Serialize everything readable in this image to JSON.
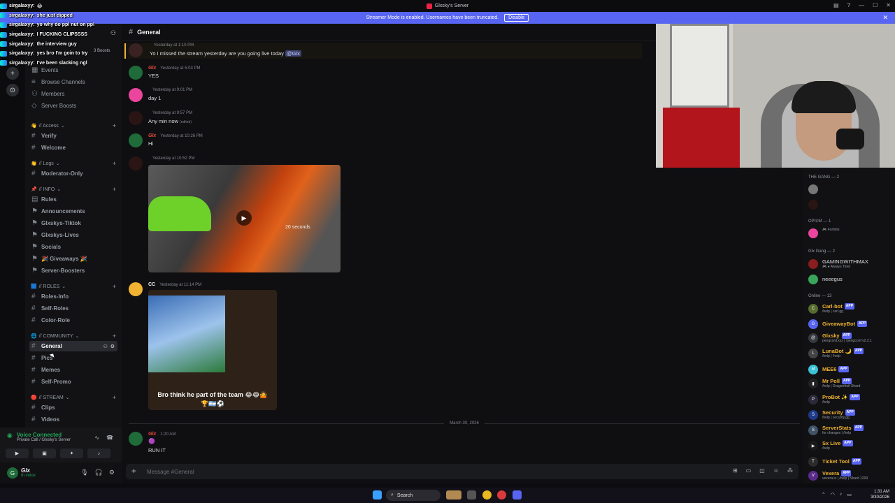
{
  "window": {
    "title": "Glxsky's Server"
  },
  "banner": {
    "text": "Streamer Mode is enabled. Usernames have been truncated.",
    "button": "Disable"
  },
  "overlay_chat": [
    {
      "user": "sirgalaxyy:",
      "text": "😂"
    },
    {
      "user": "sirgalaxyy:",
      "text": "she just dipped"
    },
    {
      "user": "sirgalaxyy:",
      "text": "yo why do ppl nut on ppl"
    },
    {
      "user": "sirgalaxyy:",
      "text": "I FUCKING CLIPSSSS"
    },
    {
      "user": "sirgalaxyy:",
      "text": "the interview guy"
    },
    {
      "user": "sirgalaxyy:",
      "text": "yes bro I'm goin to try"
    },
    {
      "user": "sirgalaxyy:",
      "text": "I've been slacking ngl"
    }
  ],
  "sidebar": {
    "server_boosts_pill": "3 Boosts",
    "top_items": [
      "Events",
      "Browse Channels",
      "Members",
      "Server Boosts"
    ],
    "categories": {
      "access": "// Access",
      "logs": "// Logs",
      "info": "// INFO",
      "roles": "// ROLES",
      "community": "// COMMUNITY",
      "stream": "// STREAM"
    },
    "channels": {
      "verify": "Verify",
      "welcome": "Welcome",
      "moderator_only": "Moderator-Only",
      "rules": "Rules",
      "announcements": "Announcements",
      "glxskys_tiktok": "Glxskys-Tiktok",
      "glxskys_lives": "Glxskys-Lives",
      "socials": "Socials",
      "giveaways": "🎉 Giveaways 🎉",
      "server_boosters": "Server-Boosters",
      "roles_info": "Roles-Info",
      "self_roles": "Self-Roles",
      "color_role": "Color-Role",
      "general": "General",
      "pics": "Pics",
      "memes": "Memes",
      "self_promo": "Self-Promo",
      "clips": "Clips",
      "videos": "Videos"
    }
  },
  "voice": {
    "status": "Voice Connected",
    "detail": "Private Call / Glxsky's Server"
  },
  "user_panel": {
    "name": "Glx",
    "status": "In voice"
  },
  "channel_header": {
    "name": "General"
  },
  "messages": [
    {
      "name": "",
      "time": "Yesterday at 1:10 PM",
      "text": "Yo I missed the stream yesterday are you going live today",
      "mention": "@Glx"
    },
    {
      "name": "Glx",
      "time": "Yesterday at 5:03 PM",
      "text": "YES"
    },
    {
      "name": "",
      "time": "Yesterday at 9:01 PM",
      "text": "day 1"
    },
    {
      "name": "",
      "time": "Yesterday at 9:57 PM",
      "text": "Any min  now",
      "edited": "(edited)"
    },
    {
      "name": "Glx",
      "time": "Yesterday at 10:26 PM",
      "text": "Hi"
    },
    {
      "name": "",
      "time": "Yesterday at 10:52 PM",
      "video_label": "20 seconds"
    },
    {
      "name": "CC",
      "time": "Yesterday at 11:14 PM",
      "caption": "Bro think he part of the team 😂😂🤷🏆🇦🇷⚽"
    },
    {
      "name": "Glx",
      "time": "1:20 AM",
      "text": "RUN IT"
    }
  ],
  "date_divider": "March 30, 2026",
  "composer": {
    "placeholder": "Message #General"
  },
  "members": {
    "groups": [
      "THE GANG — 2",
      "OPIUM — 1",
      "Glx Gang — 2",
      "Online — 13"
    ],
    "opium": [
      {
        "name": "",
        "status": "🎮 Fortnite"
      }
    ],
    "glx_gang": [
      {
        "name": "GAMINGWITHMAX",
        "status": "🎮 ● Always Tired"
      },
      {
        "name": "neeegus",
        "status": ""
      }
    ],
    "online": [
      {
        "name": "Carl-bot",
        "status": "/help | carl.gg",
        "color": "#f0b232"
      },
      {
        "name": "GiveawayBot",
        "status": "",
        "color": "#f0b232"
      },
      {
        "name": "Glxsky",
        "status": "pengcord.xyz | !pengconf v2.2.1",
        "color": "#f0b232"
      },
      {
        "name": "LunaBot 🌙",
        "status": "/help | !help",
        "color": "#f0b232"
      },
      {
        "name": "MEE6",
        "status": "",
        "color": "#f0b232"
      },
      {
        "name": "Mr Poll",
        "status": "/help | Dragonfruit Shard",
        "color": "#f0b232"
      },
      {
        "name": "ProBot ✨",
        "status": "/help",
        "color": "#f0b232"
      },
      {
        "name": "Security",
        "status": "/help | security.gg",
        "color": "#f0b232"
      },
      {
        "name": "ServerStats",
        "status": "for changes | /help",
        "color": "#f0b232"
      },
      {
        "name": "Sx Live",
        "status": "/help",
        "color": "#f0b232"
      },
      {
        "name": "Ticket Tool",
        "status": "",
        "color": "#f0b232"
      },
      {
        "name": "Vexera",
        "status": "vexera.io | /help | Shard 1209",
        "color": "#f0b232"
      }
    ],
    "app_badge": "APP"
  },
  "taskbar": {
    "search": "Search",
    "time": "1:31 AM",
    "date": "3/30/2026"
  },
  "colors": {
    "accent": "#5865f2",
    "online": "#23a55a",
    "bot_name": "#f0b232"
  }
}
